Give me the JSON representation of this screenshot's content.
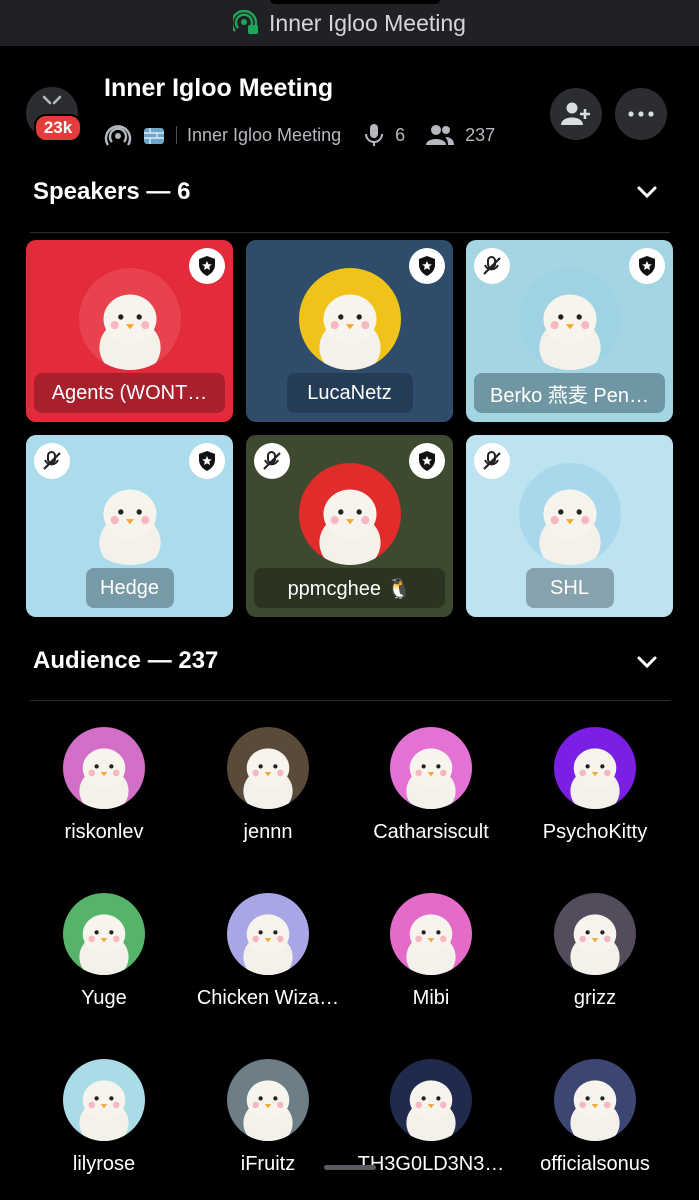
{
  "top_bar": {
    "label": "Inner Igloo Meeting",
    "icon": "stage-icon"
  },
  "header": {
    "title": "Inner Igloo Meeting",
    "badge": "23k",
    "channel_name": "Inner Igloo Meeting",
    "speaker_count": "6",
    "listener_count": "237"
  },
  "speakers_section": {
    "label": "Speakers — 6"
  },
  "speakers": [
    {
      "name": "Agents (WONT…",
      "bg": "#e42b3b",
      "label_bg": "#a8202c",
      "avatar_bg": "#e8424f",
      "moderator": true,
      "muted": false
    },
    {
      "name": "LucaNetz",
      "bg": "#2f4c6a",
      "label_bg": "#243c55",
      "avatar_bg": "#f0c21a",
      "moderator": true,
      "muted": false
    },
    {
      "name": "Berko 燕麦 Pen…",
      "bg": "#a3d5e2",
      "label_bg": "#6f97a3",
      "avatar_bg": "#9fd3e3",
      "moderator": true,
      "muted": true
    },
    {
      "name": "Hedge",
      "bg": "#acdcec",
      "label_bg": "#779ba6",
      "avatar_bg": "#acdcec",
      "moderator": true,
      "muted": true
    },
    {
      "name": "ppmcghee 🐧",
      "bg": "#3e4a2f",
      "label_bg": "#2b3421",
      "avatar_bg": "#e22b2b",
      "moderator": true,
      "muted": true
    },
    {
      "name": "SHL",
      "bg": "#bee3f0",
      "label_bg": "#86a2ad",
      "avatar_bg": "#a9d8ec",
      "moderator": false,
      "muted": true
    }
  ],
  "audience_section": {
    "label": "Audience — 237"
  },
  "audience": [
    {
      "name": "riskonlev",
      "avatar_bg": "#d26fc6"
    },
    {
      "name": "jennn",
      "avatar_bg": "#5a4a3a"
    },
    {
      "name": "Catharsiscult",
      "avatar_bg": "#e472d4"
    },
    {
      "name": "PsychoKitty",
      "avatar_bg": "#7a1fe3"
    },
    {
      "name": "Yuge",
      "avatar_bg": "#56b36a"
    },
    {
      "name": "Chicken Wiza…",
      "avatar_bg": "#a9a6e6"
    },
    {
      "name": "Mibi",
      "avatar_bg": "#e56bc9"
    },
    {
      "name": "grizz",
      "avatar_bg": "#544c5c"
    },
    {
      "name": "lilyrose",
      "avatar_bg": "#a9dce6"
    },
    {
      "name": "iFruitz",
      "avatar_bg": "#6d7e86"
    },
    {
      "name": "TH3G0LD3N3…",
      "avatar_bg": "#1f2a4d"
    },
    {
      "name": "officialsonus",
      "avatar_bg": "#3b4672"
    }
  ]
}
